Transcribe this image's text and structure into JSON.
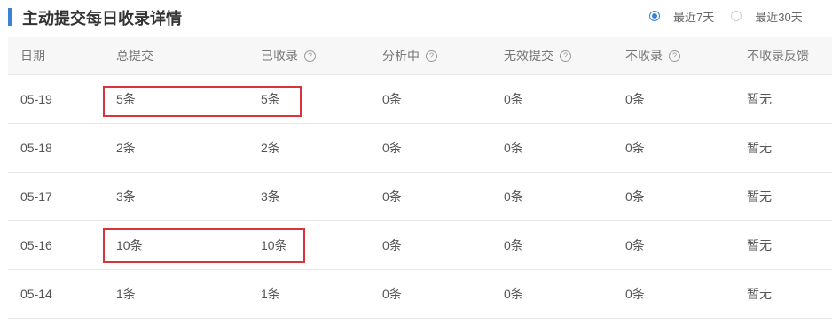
{
  "header": {
    "title": "主动提交每日收录详情",
    "range_options": [
      {
        "label": "最近7天",
        "selected": true
      },
      {
        "label": "最近30天",
        "selected": false
      }
    ]
  },
  "table": {
    "columns": [
      {
        "label": "日期",
        "help": false
      },
      {
        "label": "总提交",
        "help": false
      },
      {
        "label": "已收录",
        "help": true
      },
      {
        "label": "分析中",
        "help": true
      },
      {
        "label": "无效提交",
        "help": true
      },
      {
        "label": "不收录",
        "help": true
      },
      {
        "label": "不收录反馈",
        "help": false
      }
    ],
    "help_glyph": "?",
    "rows": [
      {
        "date": "05-19",
        "total": "5条",
        "indexed": "5条",
        "analyzing": "0条",
        "invalid": "0条",
        "not_indexed": "0条",
        "feedback": "暂无",
        "highlighted": true
      },
      {
        "date": "05-18",
        "total": "2条",
        "indexed": "2条",
        "analyzing": "0条",
        "invalid": "0条",
        "not_indexed": "0条",
        "feedback": "暂无",
        "highlighted": false
      },
      {
        "date": "05-17",
        "total": "3条",
        "indexed": "3条",
        "analyzing": "0条",
        "invalid": "0条",
        "not_indexed": "0条",
        "feedback": "暂无",
        "highlighted": false
      },
      {
        "date": "05-16",
        "total": "10条",
        "indexed": "10条",
        "analyzing": "0条",
        "invalid": "0条",
        "not_indexed": "0条",
        "feedback": "暂无",
        "highlighted": true
      },
      {
        "date": "05-14",
        "total": "1条",
        "indexed": "1条",
        "analyzing": "0条",
        "invalid": "0条",
        "not_indexed": "0条",
        "feedback": "暂无",
        "highlighted": false
      }
    ]
  },
  "colors": {
    "accent": "#3b82d6",
    "highlight_border": "#d9343b",
    "header_bg": "#f7f7f7"
  }
}
